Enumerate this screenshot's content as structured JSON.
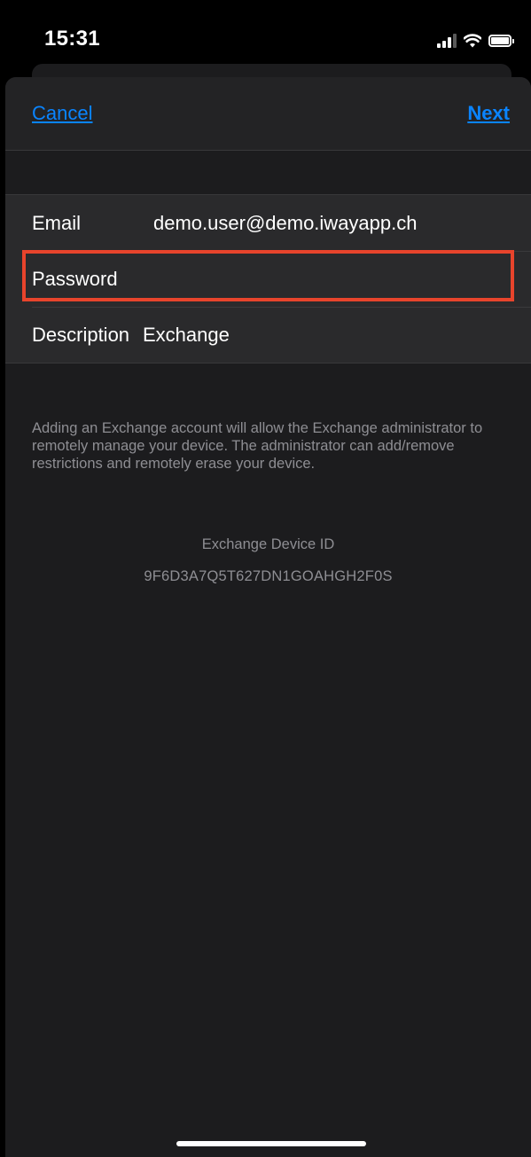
{
  "status_bar": {
    "time": "15:31",
    "icons": [
      "cellular-signal-icon",
      "wifi-icon",
      "battery-icon"
    ]
  },
  "nav": {
    "cancel_label": "Cancel",
    "next_label": "Next"
  },
  "form": {
    "email": {
      "label": "Email",
      "value": "demo.user@demo.iwayapp.ch"
    },
    "password": {
      "label": "Password",
      "value": ""
    },
    "description": {
      "label": "Description",
      "value": "Exchange"
    }
  },
  "info": {
    "text": "Adding an Exchange account will allow the Exchange administrator to remotely manage your device. The administrator can add/remove restrictions and remotely erase your device.",
    "device_id_label": "Exchange Device ID",
    "device_id_value": "9F6D3A7Q5T627DN1GOAHGH2F0S"
  },
  "colors": {
    "accent": "#0a84ff",
    "highlight": "#e8442c",
    "sheet_background": "#1c1c1e",
    "secondary_text": "#8e8e93"
  }
}
